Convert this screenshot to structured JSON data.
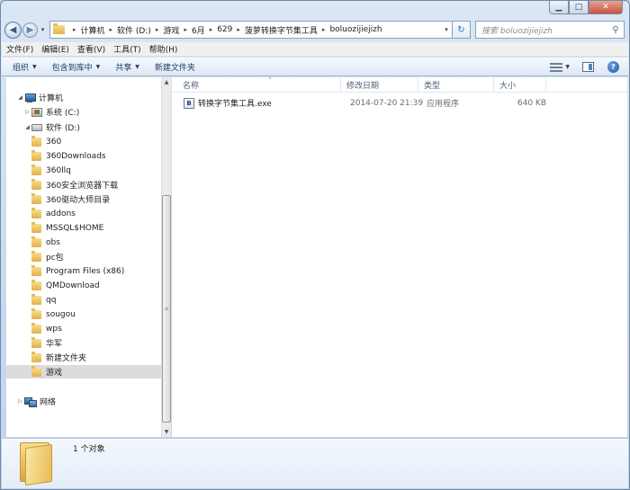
{
  "window": {
    "caption": {
      "minimize": "▁",
      "maximize": "□",
      "close": "✕"
    }
  },
  "nav": {
    "back_icon": "◀",
    "forward_icon": "▶",
    "dropdown_icon": "▾",
    "breadcrumbs": [
      "计算机",
      "软件 (D:)",
      "游戏",
      "6月",
      "629",
      "菠萝转换字节集工具",
      "boluozijiejizh"
    ],
    "refresh_icon": "↻",
    "search_placeholder": "搜索 boluozijiejizh",
    "search_icon": "🔍"
  },
  "menubar": [
    "文件(F)",
    "编辑(E)",
    "查看(V)",
    "工具(T)",
    "帮助(H)"
  ],
  "commandbar": {
    "items": [
      {
        "label": "组织",
        "has_dropdown": true
      },
      {
        "label": "包含到库中",
        "has_dropdown": true
      },
      {
        "label": "共享",
        "has_dropdown": true
      },
      {
        "label": "新建文件夹",
        "has_dropdown": false
      }
    ],
    "help": "?"
  },
  "navpane": {
    "computer": "计算机",
    "drive_c": "系统 (C:)",
    "drive_d": "软件 (D:)",
    "folders": [
      "360",
      "360Downloads",
      "360llq",
      "360安全浏览器下载",
      "360驱动大师目录",
      "addons",
      "MSSQL$HOME",
      "obs",
      "pc包",
      "Program Files (x86)",
      "QMDownload",
      "qq",
      "sougou",
      "wps",
      "华军",
      "新建文件夹",
      "游戏"
    ],
    "selected": "游戏",
    "network": "网络"
  },
  "columns": {
    "name": "名称",
    "date": "修改日期",
    "type": "类型",
    "size": "大小"
  },
  "files": [
    {
      "icon_letter": "B",
      "name": "转换字节集工具.exe",
      "date": "2014-07-20 21:39",
      "type": "应用程序",
      "size": "640 KB"
    }
  ],
  "details": {
    "count": "1 个对象"
  },
  "colors": {
    "titlebar": "#dbe7f5",
    "selected": "#dcdcdc",
    "accent": "#2f6bb8"
  }
}
